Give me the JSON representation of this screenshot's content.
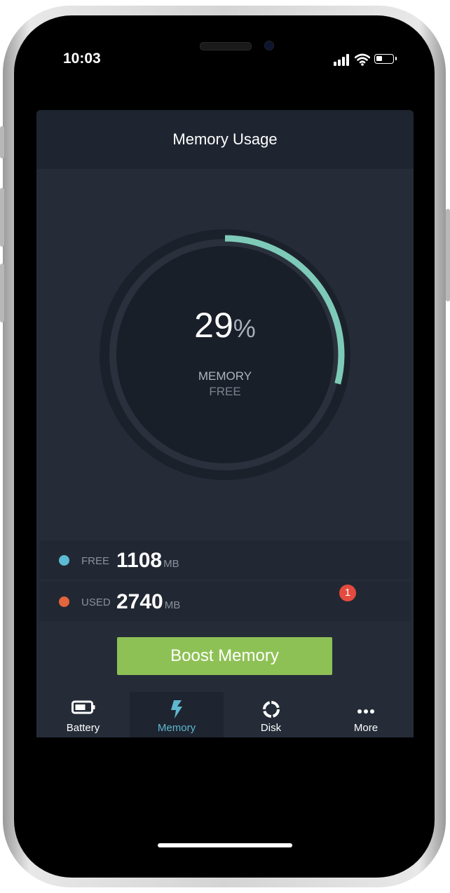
{
  "status_bar": {
    "time": "10:03"
  },
  "header": {
    "title": "Memory Usage"
  },
  "gauge": {
    "percent": "29",
    "percent_fraction": 0.29,
    "unit": "%",
    "label_line1": "MEMORY",
    "label_line2": "FREE"
  },
  "stats": [
    {
      "label": "FREE",
      "value": "1108",
      "unit": "MB",
      "color": "#5bbcd3"
    },
    {
      "label": "USED",
      "value": "2740",
      "unit": "MB",
      "color": "#e2653b"
    }
  ],
  "boost_button": {
    "label": "Boost Memory"
  },
  "tabs": [
    {
      "label": "Battery",
      "icon": "battery-icon",
      "active": false
    },
    {
      "label": "Memory",
      "icon": "lightning-icon",
      "active": true
    },
    {
      "label": "Disk",
      "icon": "disk-icon",
      "active": false
    },
    {
      "label": "More",
      "icon": "more-icon",
      "active": false,
      "badge": "1"
    }
  ],
  "colors": {
    "accent": "#5fb8cf",
    "gauge_arc": "#7ecab8",
    "boost_green": "#8ec155",
    "badge_red": "#e34b3f"
  }
}
